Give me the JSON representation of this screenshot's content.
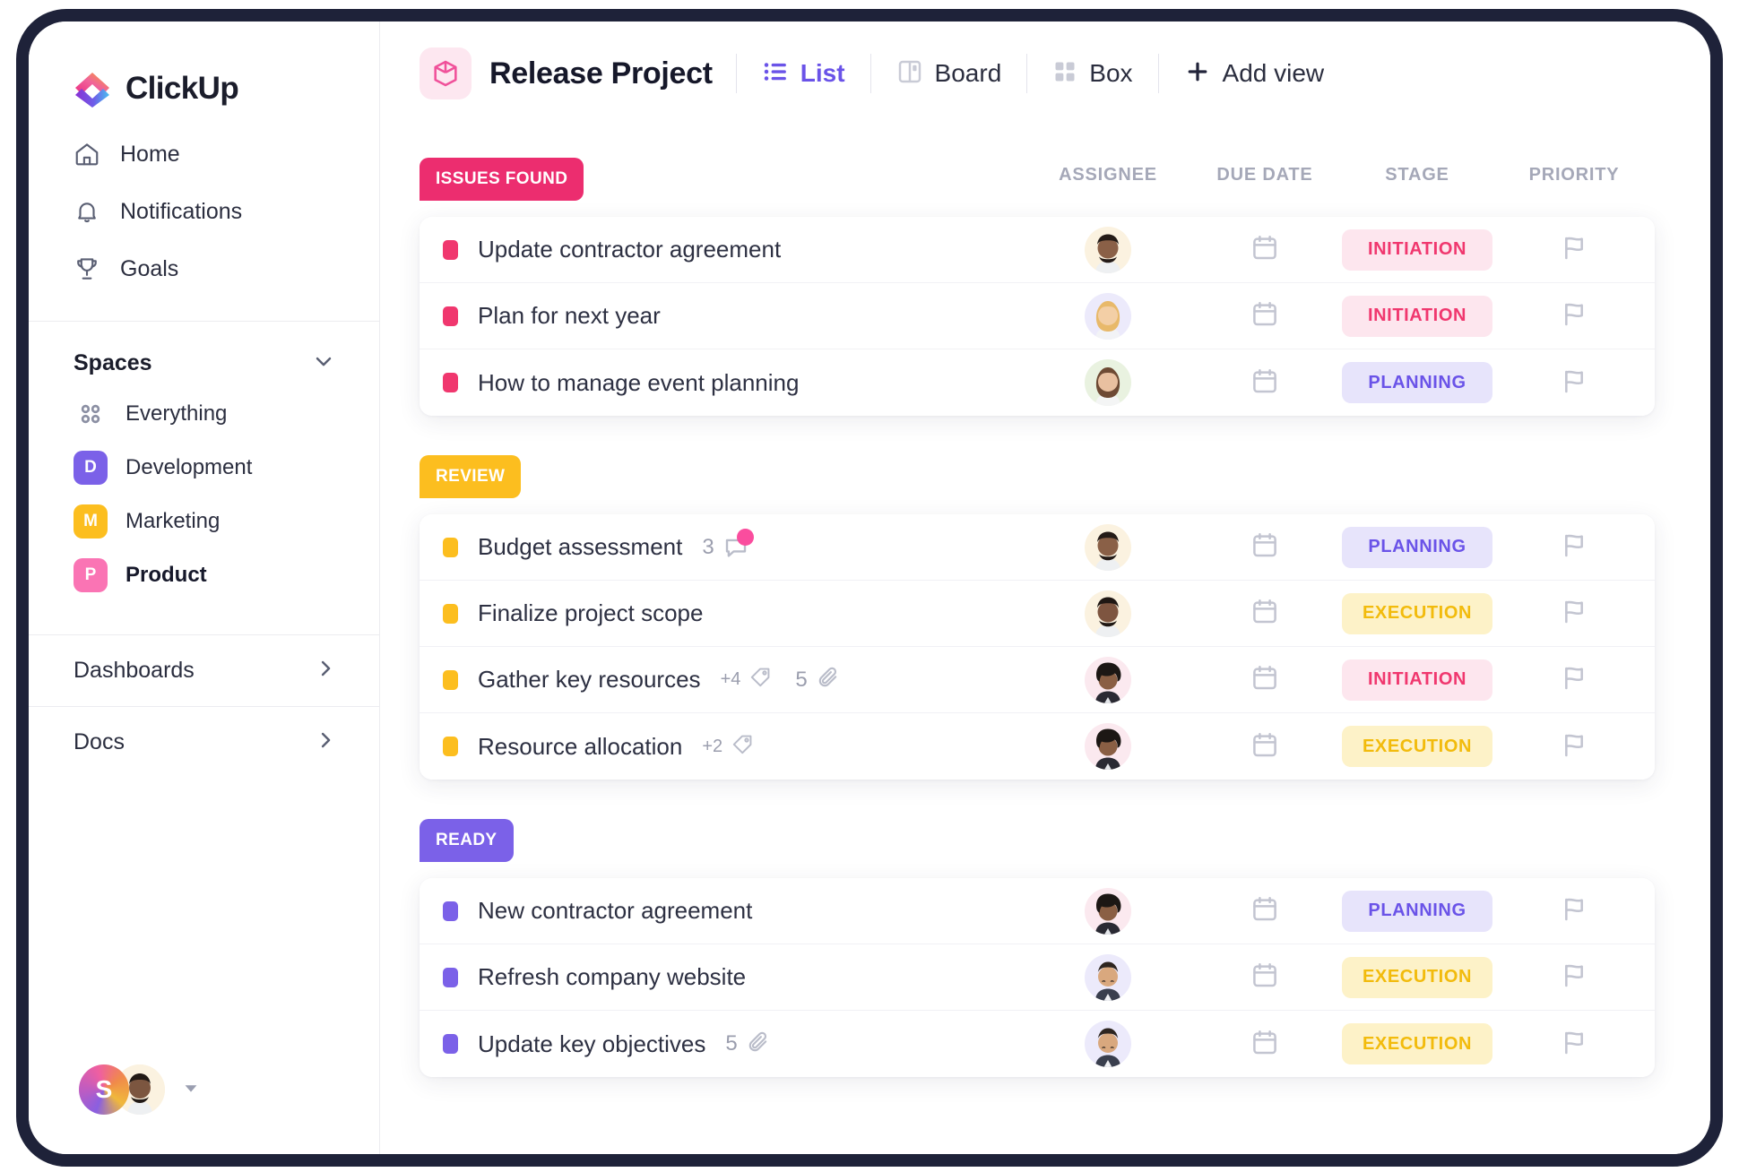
{
  "app": {
    "brand": "ClickUp"
  },
  "sidebar": {
    "nav": [
      {
        "label": "Home",
        "icon": "home-icon"
      },
      {
        "label": "Notifications",
        "icon": "bell-icon"
      },
      {
        "label": "Goals",
        "icon": "trophy-icon"
      }
    ],
    "spaces_title": "Spaces",
    "spaces_toggle_icon": "chevron-down-icon",
    "spaces": [
      {
        "label": "Everything",
        "type": "icon",
        "icon": "grid-icon",
        "selected": false
      },
      {
        "label": "Development",
        "type": "badge",
        "initial": "D",
        "color": "#7b61e8",
        "selected": false
      },
      {
        "label": "Marketing",
        "type": "badge",
        "initial": "M",
        "color": "#fcbe1f",
        "selected": false
      },
      {
        "label": "Product",
        "type": "badge",
        "initial": "P",
        "color": "#fa74b4",
        "selected": true
      }
    ],
    "sections": [
      {
        "label": "Dashboards",
        "icon": "chevron-right-icon"
      },
      {
        "label": "Docs",
        "icon": "chevron-right-icon"
      }
    ],
    "user": {
      "workspace_initial": "S",
      "avatar_icon": "user-avatar",
      "caret_icon": "caret-down-icon"
    }
  },
  "header": {
    "project_icon": "cube-icon",
    "title": "Release Project",
    "views": [
      {
        "label": "List",
        "icon": "list-icon",
        "active": true
      },
      {
        "label": "Board",
        "icon": "board-icon",
        "active": false
      },
      {
        "label": "Box",
        "icon": "box-icon",
        "active": false
      }
    ],
    "add_view": {
      "label": "Add view",
      "icon": "plus-icon"
    }
  },
  "columns": {
    "assignee": "ASSIGNEE",
    "due_date": "DUE DATE",
    "stage": "STAGE",
    "priority": "PRIORITY"
  },
  "stage_colors": {
    "INITIATION": {
      "bg": "#fde6ee",
      "fg": "#f0376e"
    },
    "PLANNING": {
      "bg": "#e7e4fb",
      "fg": "#6a53e8"
    },
    "EXECUTION": {
      "bg": "#fdf2c8",
      "fg": "#f2bb0c"
    }
  },
  "groups": [
    {
      "name": "ISSUES FOUND",
      "color": "#ec2d6f",
      "dot_color": "#f0376e",
      "tasks": [
        {
          "name": "Update contractor agreement",
          "stage": "INITIATION",
          "avatar_bg": "#fbf2e0",
          "avatar_type": "man-beard",
          "meta": []
        },
        {
          "name": "Plan for next year",
          "stage": "INITIATION",
          "avatar_bg": "#eceafb",
          "avatar_type": "woman-blonde",
          "meta": []
        },
        {
          "name": "How to manage event planning",
          "stage": "PLANNING",
          "avatar_bg": "#e9f2e0",
          "avatar_type": "woman-brown",
          "meta": []
        }
      ]
    },
    {
      "name": "REVIEW",
      "color": "#fcbe1f",
      "dot_color": "#fcbe1f",
      "tasks": [
        {
          "name": "Budget assessment",
          "stage": "PLANNING",
          "avatar_bg": "#fbf2e0",
          "avatar_type": "man-beard",
          "meta": [
            {
              "type": "comments",
              "value": "3",
              "icon": "comment-icon",
              "unread": true
            }
          ]
        },
        {
          "name": "Finalize project scope",
          "stage": "EXECUTION",
          "avatar_bg": "#fbf2e0",
          "avatar_type": "man-beard",
          "meta": []
        },
        {
          "name": "Gather key resources",
          "stage": "INITIATION",
          "avatar_bg": "#fbe9ef",
          "avatar_type": "man-afro",
          "meta": [
            {
              "type": "tags",
              "value": "+4",
              "icon": "tag-icon",
              "small": true
            },
            {
              "type": "attachments",
              "value": "5",
              "icon": "paperclip-icon"
            }
          ]
        },
        {
          "name": "Resource allocation",
          "stage": "EXECUTION",
          "avatar_bg": "#fbe9ef",
          "avatar_type": "man-afro",
          "meta": [
            {
              "type": "tags",
              "value": "+2",
              "icon": "tag-icon",
              "small": true
            }
          ]
        }
      ]
    },
    {
      "name": "READY",
      "color": "#7b61e8",
      "dot_color": "#7b61e8",
      "tasks": [
        {
          "name": "New contractor agreement",
          "stage": "PLANNING",
          "avatar_bg": "#fbe9ef",
          "avatar_type": "man-afro",
          "meta": []
        },
        {
          "name": "Refresh company website",
          "stage": "EXECUTION",
          "avatar_bg": "#eceafb",
          "avatar_type": "man-short",
          "meta": []
        },
        {
          "name": "Update key objectives",
          "stage": "EXECUTION",
          "avatar_bg": "#eceafb",
          "avatar_type": "man-short",
          "meta": [
            {
              "type": "attachments",
              "value": "5",
              "icon": "paperclip-icon"
            }
          ]
        }
      ]
    }
  ]
}
